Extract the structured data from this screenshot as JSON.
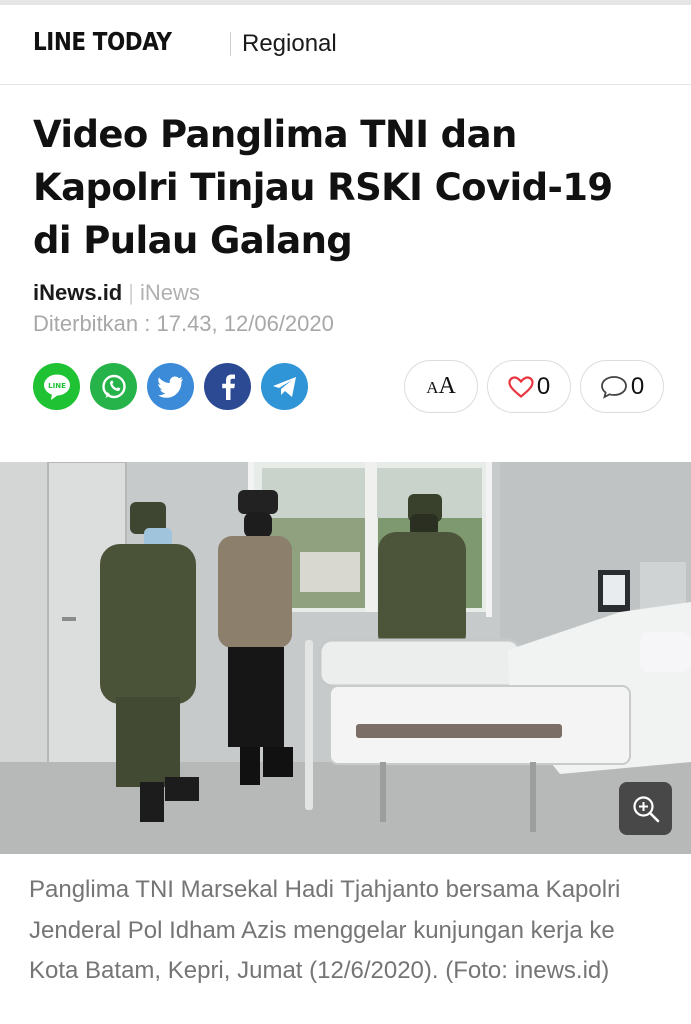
{
  "header": {
    "logo_text": "LINE TODAY",
    "section": "Regional"
  },
  "article": {
    "title": "Video Panglima TNI dan Kapolri Tinjau RSKI Covid-19 di Pulau Galang",
    "publisher": "iNews.id",
    "brand": "iNews",
    "published": "Diterbitkan : 17.43, 12/06/2020",
    "caption": "Panglima TNI Marsekal Hadi Tjahjanto bersama Kapolri Jenderal Pol Idham Azis menggelar kunjungan kerja ke Kota Batam, Kepri, Jumat (12/6/2020). (Foto: inews.id)"
  },
  "share": [
    {
      "icon": "line-icon",
      "label": "LINE",
      "color": "#1fc232"
    },
    {
      "icon": "whatsapp-icon",
      "color": "#25b34a"
    },
    {
      "icon": "twitter-icon",
      "color": "#3b8bd8"
    },
    {
      "icon": "facebook-icon",
      "color": "#2c4a93"
    },
    {
      "icon": "telegram-icon",
      "color": "#2f95d6"
    }
  ],
  "actions": {
    "font_size_label": "AA",
    "like_count": "0",
    "comment_count": "0",
    "like_color": "#e8353f"
  }
}
